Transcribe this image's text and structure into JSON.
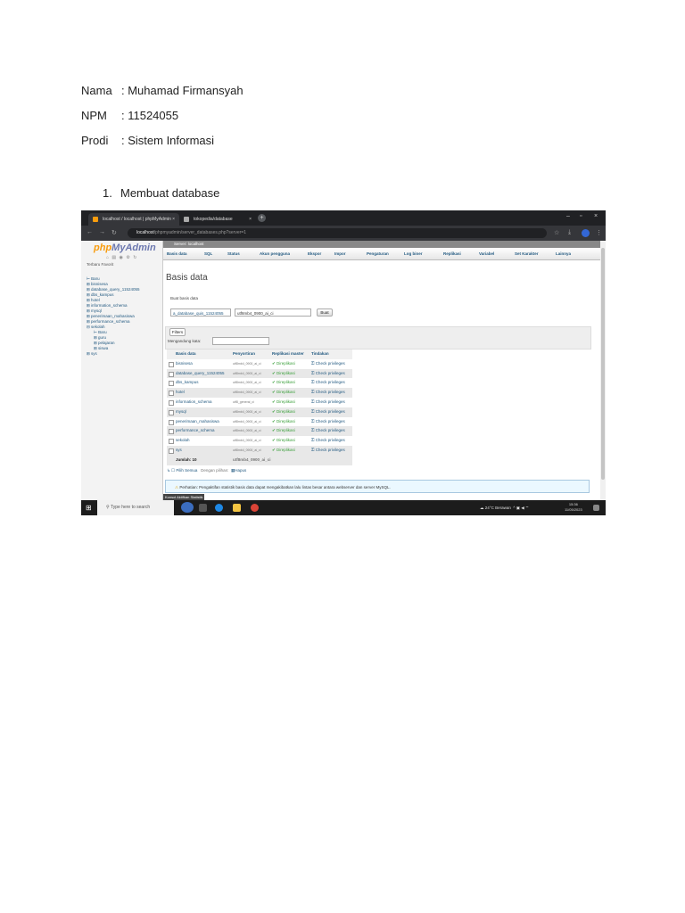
{
  "doc": {
    "fields": [
      {
        "key": "Nama",
        "value": ": Muhamad Firmansyah"
      },
      {
        "key": "NPM",
        "value": ": 11524055"
      },
      {
        "key": "Prodi",
        "value": ": Sistem Informasi"
      }
    ],
    "section_number": "1.",
    "section_title": "Membuat database"
  },
  "browser": {
    "tabs": [
      {
        "label": "localhost / localhost | phpMyAdmin",
        "active": true
      },
      {
        "label": "tokopedia/database",
        "active": false
      }
    ],
    "url_host": "localhost",
    "url_path": "/phpmyadmin/server_databases.php?server=1"
  },
  "sidebar": {
    "logo_php": "php",
    "logo_myadmin": "MyAdmin",
    "recent": "Terbaru",
    "favorite": "Favorit",
    "tree": [
      "Baru",
      "bisnisesa",
      "database_query_11524055",
      "dbs_kampus",
      "hotel",
      "information_schema",
      "mysql",
      "penerimaan_mahasiswa",
      "performance_schema",
      "sekolah",
      "Baru",
      "guru",
      "pelajaran",
      "siswa",
      "sys"
    ]
  },
  "main": {
    "breadcrumb": "Server: localhost",
    "menu": [
      "Basis data",
      "SQL",
      "Status",
      "Akun pengguna",
      "Ekspor",
      "Impor",
      "Pengaturan",
      "Log biner",
      "Replikasi",
      "Variabel",
      "Set Karakter",
      "Lainnya"
    ],
    "title": "Basis data",
    "create_label": "Buat basis data",
    "create_name_value": "a_database_quis_11524055",
    "collation_value": "utf8mb4_0900_ai_ci",
    "create_button": "Buat",
    "filters_label": "Filters",
    "filter_containing": "Mengandung kata:",
    "table_headers": [
      "Basis data",
      "Penyortiran",
      "Replikasi master",
      "Tindakan"
    ],
    "rows": [
      {
        "name": "bisnisesa",
        "collation": "utf8mb4_0900_ai_ci",
        "replication": "Direplikasi",
        "action": "Check privileges"
      },
      {
        "name": "database_query_11524055",
        "collation": "utf8mb4_0900_ai_ci",
        "replication": "Direplikasi",
        "action": "Check privileges"
      },
      {
        "name": "dbs_kampus",
        "collation": "utf8mb4_0900_ai_ci",
        "replication": "Direplikasi",
        "action": "Check privileges"
      },
      {
        "name": "hotel",
        "collation": "utf8mb4_0900_ai_ci",
        "replication": "Direplikasi",
        "action": "Check privileges"
      },
      {
        "name": "information_schema",
        "collation": "utf8_general_ci",
        "replication": "Direplikasi",
        "action": "Check privileges"
      },
      {
        "name": "mysql",
        "collation": "utf8mb4_0900_ai_ci",
        "replication": "Direplikasi",
        "action": "Check privileges"
      },
      {
        "name": "penerimaan_mahasiswa",
        "collation": "utf8mb4_0900_ai_ci",
        "replication": "Direplikasi",
        "action": "Check privileges"
      },
      {
        "name": "performance_schema",
        "collation": "utf8mb4_0900_ai_ci",
        "replication": "Direplikasi",
        "action": "Check privileges"
      },
      {
        "name": "sekolah",
        "collation": "utf8mb4_0900_ai_ci",
        "replication": "Direplikasi",
        "action": "Check privileges"
      },
      {
        "name": "sys",
        "collation": "utf8mb4_0900_ai_ci",
        "replication": "Direplikasi",
        "action": "Check privileges"
      }
    ],
    "total_label": "Jumlah: 10",
    "total_collation": "utf8mb4_0900_ai_ci",
    "select_all": "Pilih Semua",
    "with_selected": "Dengan pilihan:",
    "drop": "Hapus",
    "notice": "Perhatian: Pengaktifan statistik basis data dapat mengakibatkan lalu lintas besar antara webserver dan server MySQL.",
    "console": "Konsol",
    "stats_link": "Aktifkan Statistik"
  },
  "taskbar": {
    "search_placeholder": "Type here to search",
    "weather": "24°C  Berawan",
    "time": "15:36",
    "date": "11/05/2023"
  }
}
